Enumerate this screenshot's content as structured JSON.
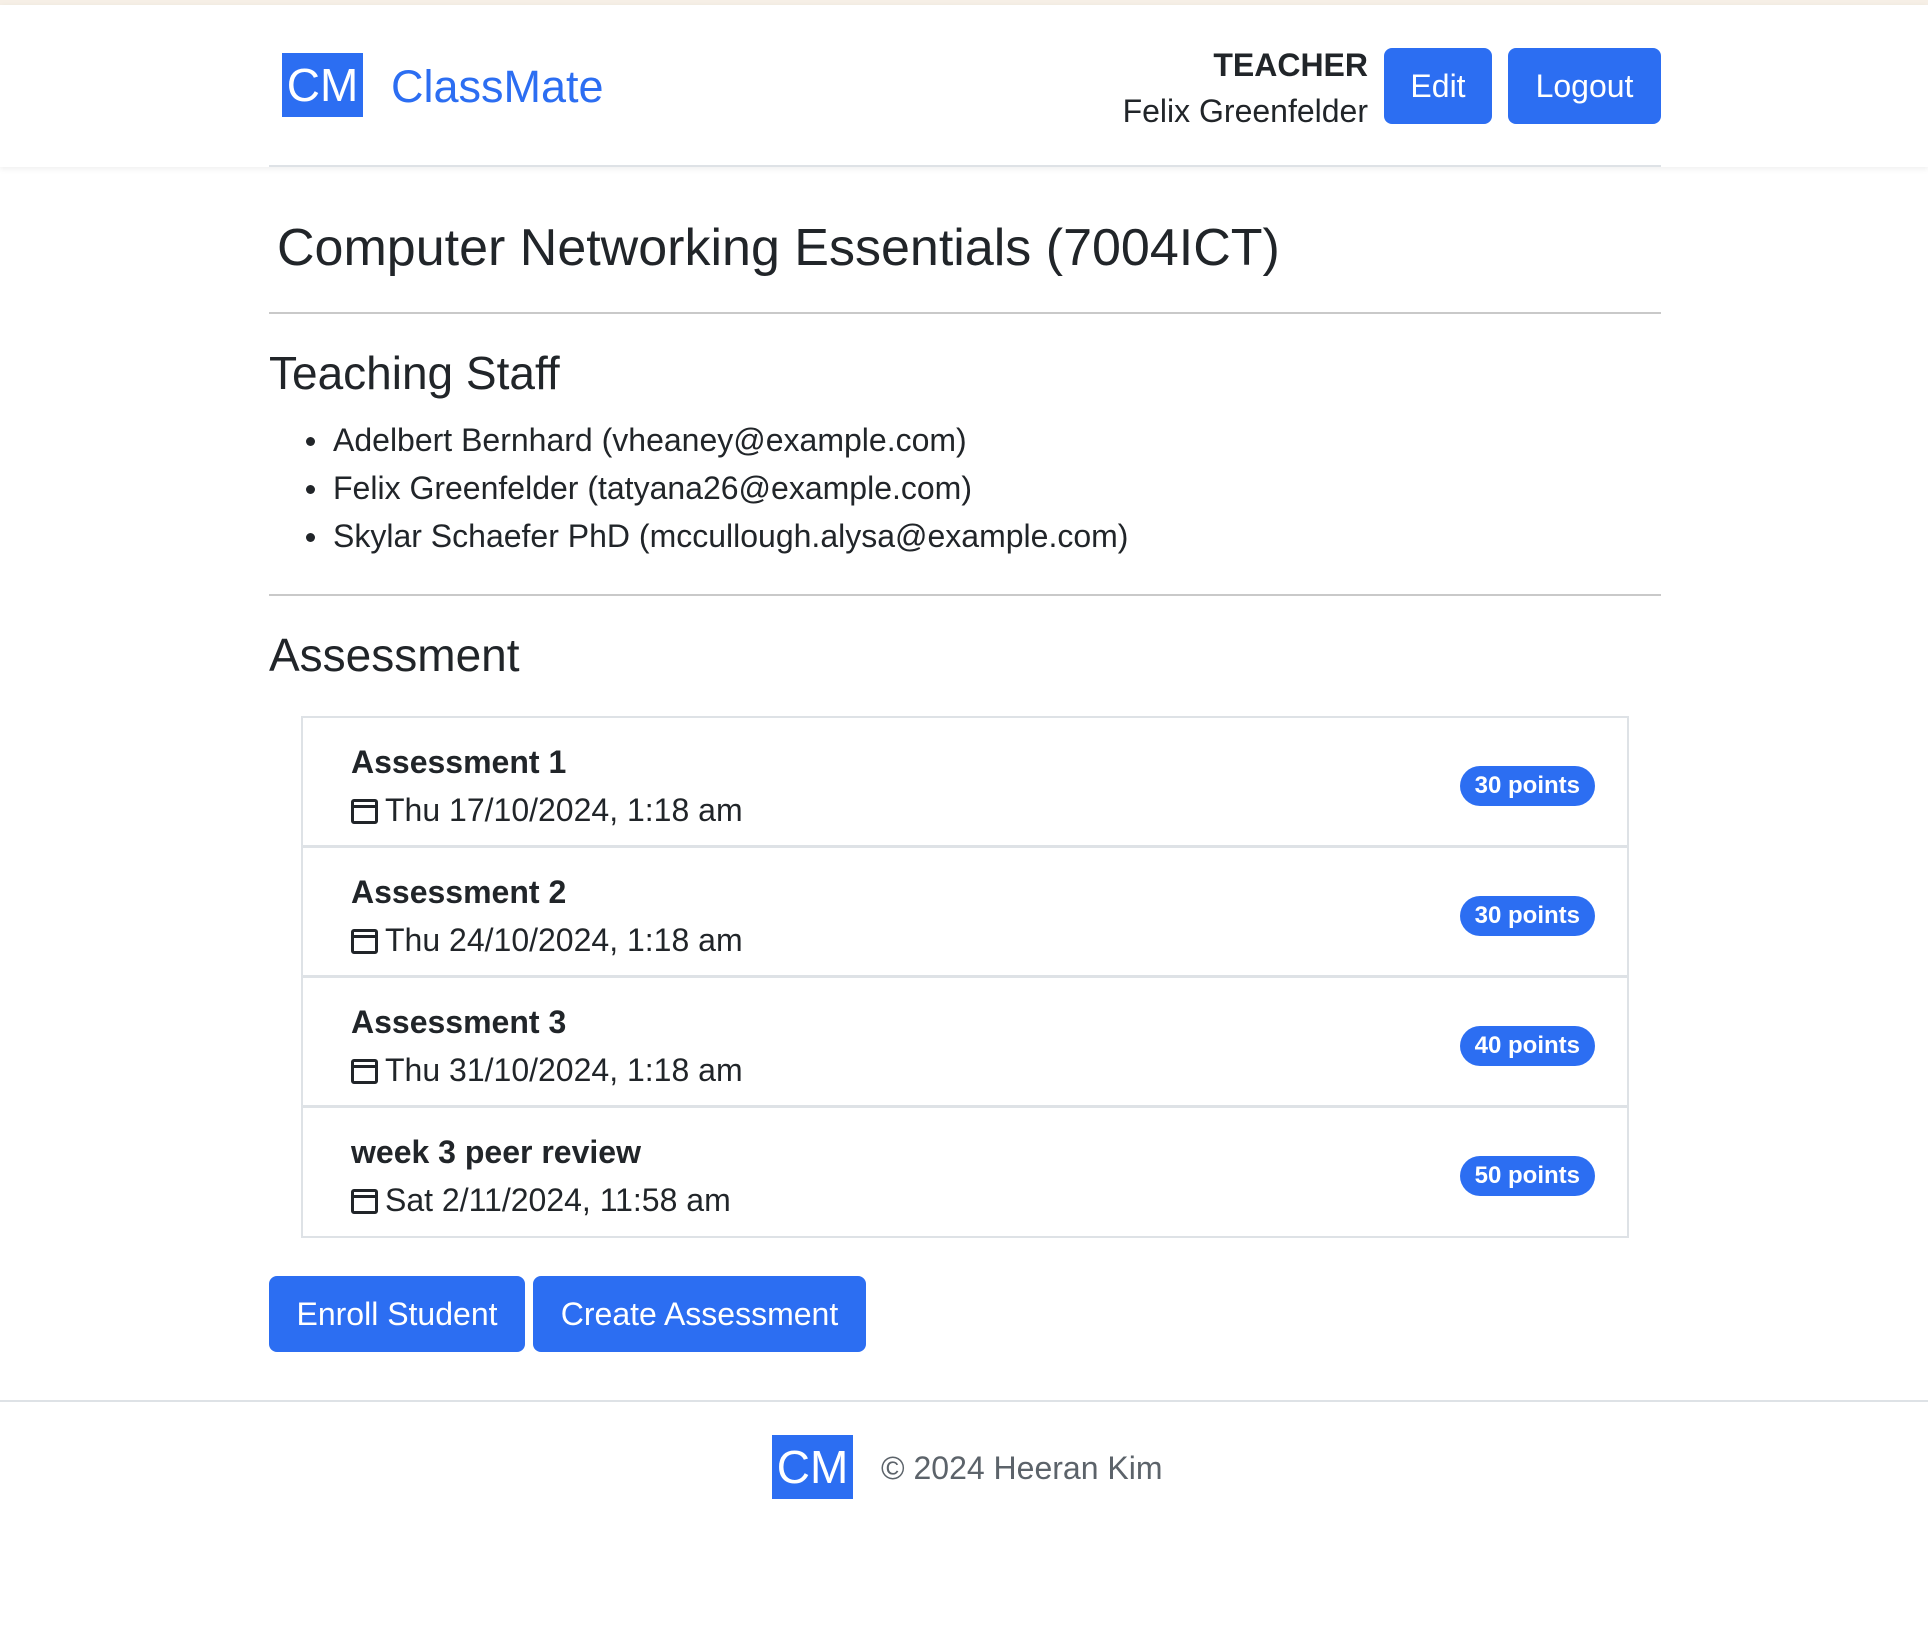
{
  "header": {
    "logo_text": "CM",
    "brand": "ClassMate",
    "role": "TEACHER",
    "user_name": "Felix Greenfelder",
    "edit_label": "Edit",
    "logout_label": "Logout"
  },
  "course": {
    "title": "Computer Networking Essentials (7004ICT)"
  },
  "staff": {
    "heading": "Teaching Staff",
    "members": [
      "Adelbert Bernhard (vheaney@example.com)",
      "Felix Greenfelder (tatyana26@example.com)",
      "Skylar Schaefer PhD (mccullough.alysa@example.com)"
    ]
  },
  "assessment": {
    "heading": "Assessment",
    "items": [
      {
        "name": "Assessment 1",
        "date": "Thu 17/10/2024, 1:18 am",
        "points": "30 points"
      },
      {
        "name": "Assessment 2",
        "date": "Thu 24/10/2024, 1:18 am",
        "points": "30 points"
      },
      {
        "name": "Assessment 3",
        "date": "Thu 31/10/2024, 1:18 am",
        "points": "40 points"
      },
      {
        "name": "week 3 peer review",
        "date": "Sat 2/11/2024, 11:58 am",
        "points": "50 points"
      }
    ],
    "icon": "calendar-icon"
  },
  "actions": {
    "enroll_label": "Enroll Student",
    "create_label": "Create Assessment"
  },
  "footer": {
    "logo_text": "CM",
    "copyright": "© 2024 Heeran Kim"
  },
  "colors": {
    "accent": "#2c6ef2",
    "text": "#212529",
    "muted": "#5c636a",
    "border": "#dee2e6"
  }
}
